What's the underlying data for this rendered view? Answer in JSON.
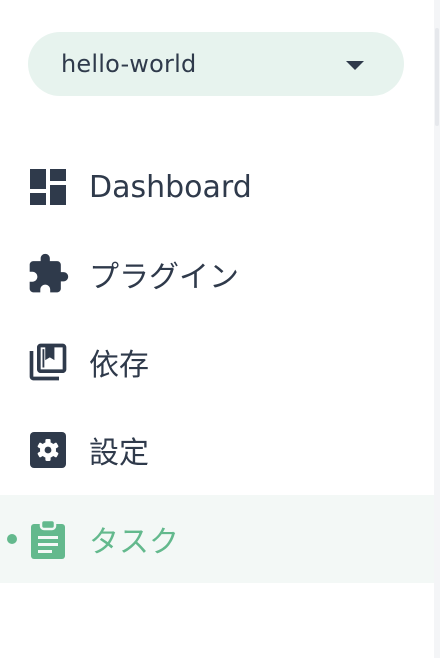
{
  "project_selector": {
    "value": "hello-world",
    "caret_icon": "arrow-drop-down-icon"
  },
  "nav": {
    "items": [
      {
        "label": "Dashboard",
        "icon": "dashboard-icon",
        "active": false
      },
      {
        "label": "プラグイン",
        "icon": "puzzle-icon",
        "active": false
      },
      {
        "label": "依存",
        "icon": "library-books-icon",
        "active": false
      },
      {
        "label": "設定",
        "icon": "settings-icon",
        "active": false
      },
      {
        "label": "タスク",
        "icon": "assignment-icon",
        "active": true
      }
    ]
  },
  "colors": {
    "text": "#2f3a4b",
    "accent": "#63b98d",
    "select_bg": "#e7f3ee",
    "active_bg": "#f3f8f6"
  }
}
